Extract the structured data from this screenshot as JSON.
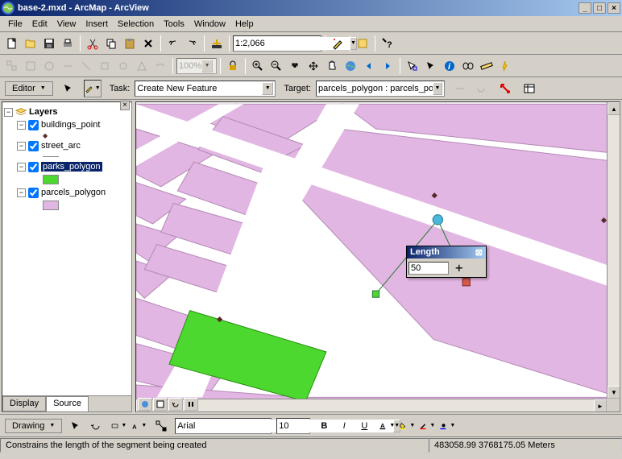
{
  "title": "base-2.mxd - ArcMap - ArcView",
  "menus": [
    "File",
    "Edit",
    "View",
    "Insert",
    "Selection",
    "Tools",
    "Window",
    "Help"
  ],
  "scale": "1:2,066",
  "editor": {
    "label": "Editor",
    "task_label": "Task:",
    "task_value": "Create New Feature",
    "target_label": "Target:",
    "target_value": "parcels_polygon : parcels_poly"
  },
  "toc": {
    "root": "Layers",
    "layers": [
      {
        "name": "buildings_point",
        "checked": true,
        "expanded": true
      },
      {
        "name": "street_arc",
        "checked": true,
        "expanded": true
      },
      {
        "name": "parks_polygon",
        "checked": true,
        "expanded": true,
        "selected": true,
        "swatch": "#4dd82f"
      },
      {
        "name": "parcels_polygon",
        "checked": true,
        "expanded": true,
        "swatch": "#e2b6e2"
      }
    ],
    "tabs": {
      "display": "Display",
      "source": "Source"
    }
  },
  "length_popup": {
    "title": "Length",
    "value": "50"
  },
  "drawing": {
    "label": "Drawing",
    "font": "Arial",
    "size": "10"
  },
  "status": {
    "message": "Constrains the length of the segment being created",
    "coords": "483058.99  3768175.05 Meters"
  }
}
